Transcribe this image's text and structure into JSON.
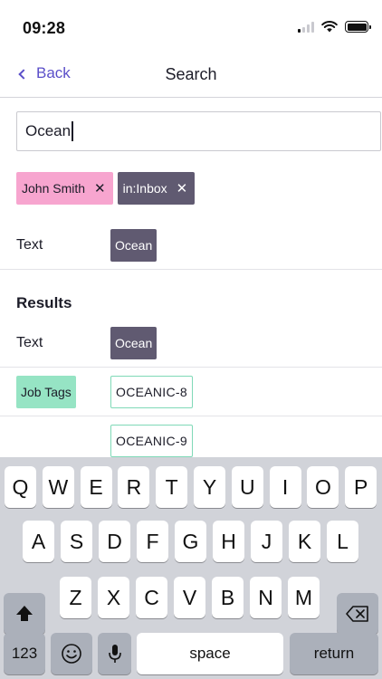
{
  "status": {
    "time": "09:28"
  },
  "nav": {
    "back_label": "Back",
    "title": "Search"
  },
  "search": {
    "value": "Ocean"
  },
  "chips": [
    {
      "label": "John Smith",
      "remove": "✕",
      "color": "#f7a5cf"
    },
    {
      "label": "in:Inbox",
      "remove": "✕",
      "color": "#605a71"
    }
  ],
  "filter_row": {
    "label": "Text",
    "tag": "Ocean"
  },
  "results": {
    "heading": "Results",
    "text_row": {
      "label": "Text",
      "tag": "Ocean"
    },
    "job_tags_row": {
      "label": "Job Tags",
      "tags": [
        "OCEANIC-8",
        "OCEANIC-9"
      ]
    }
  },
  "keyboard": {
    "row1": [
      "Q",
      "W",
      "E",
      "R",
      "T",
      "Y",
      "U",
      "I",
      "O",
      "P"
    ],
    "row2": [
      "A",
      "S",
      "D",
      "F",
      "G",
      "H",
      "J",
      "K",
      "L"
    ],
    "row3": [
      "Z",
      "X",
      "C",
      "V",
      "B",
      "N",
      "M"
    ],
    "numbers_label": "123",
    "space_label": "space",
    "return_label": "return",
    "icons": {
      "shift": "shift-icon",
      "backspace": "backspace-icon",
      "emoji": "emoji-icon",
      "mic": "microphone-icon"
    }
  },
  "colors": {
    "accent": "#5b4fc9",
    "chip_pink": "#f7a5cf",
    "chip_dark": "#605a71",
    "tag_green": "#96e4c4",
    "tag_outline": "#7fd9b7",
    "keyboard_bg": "#d1d3d9"
  }
}
